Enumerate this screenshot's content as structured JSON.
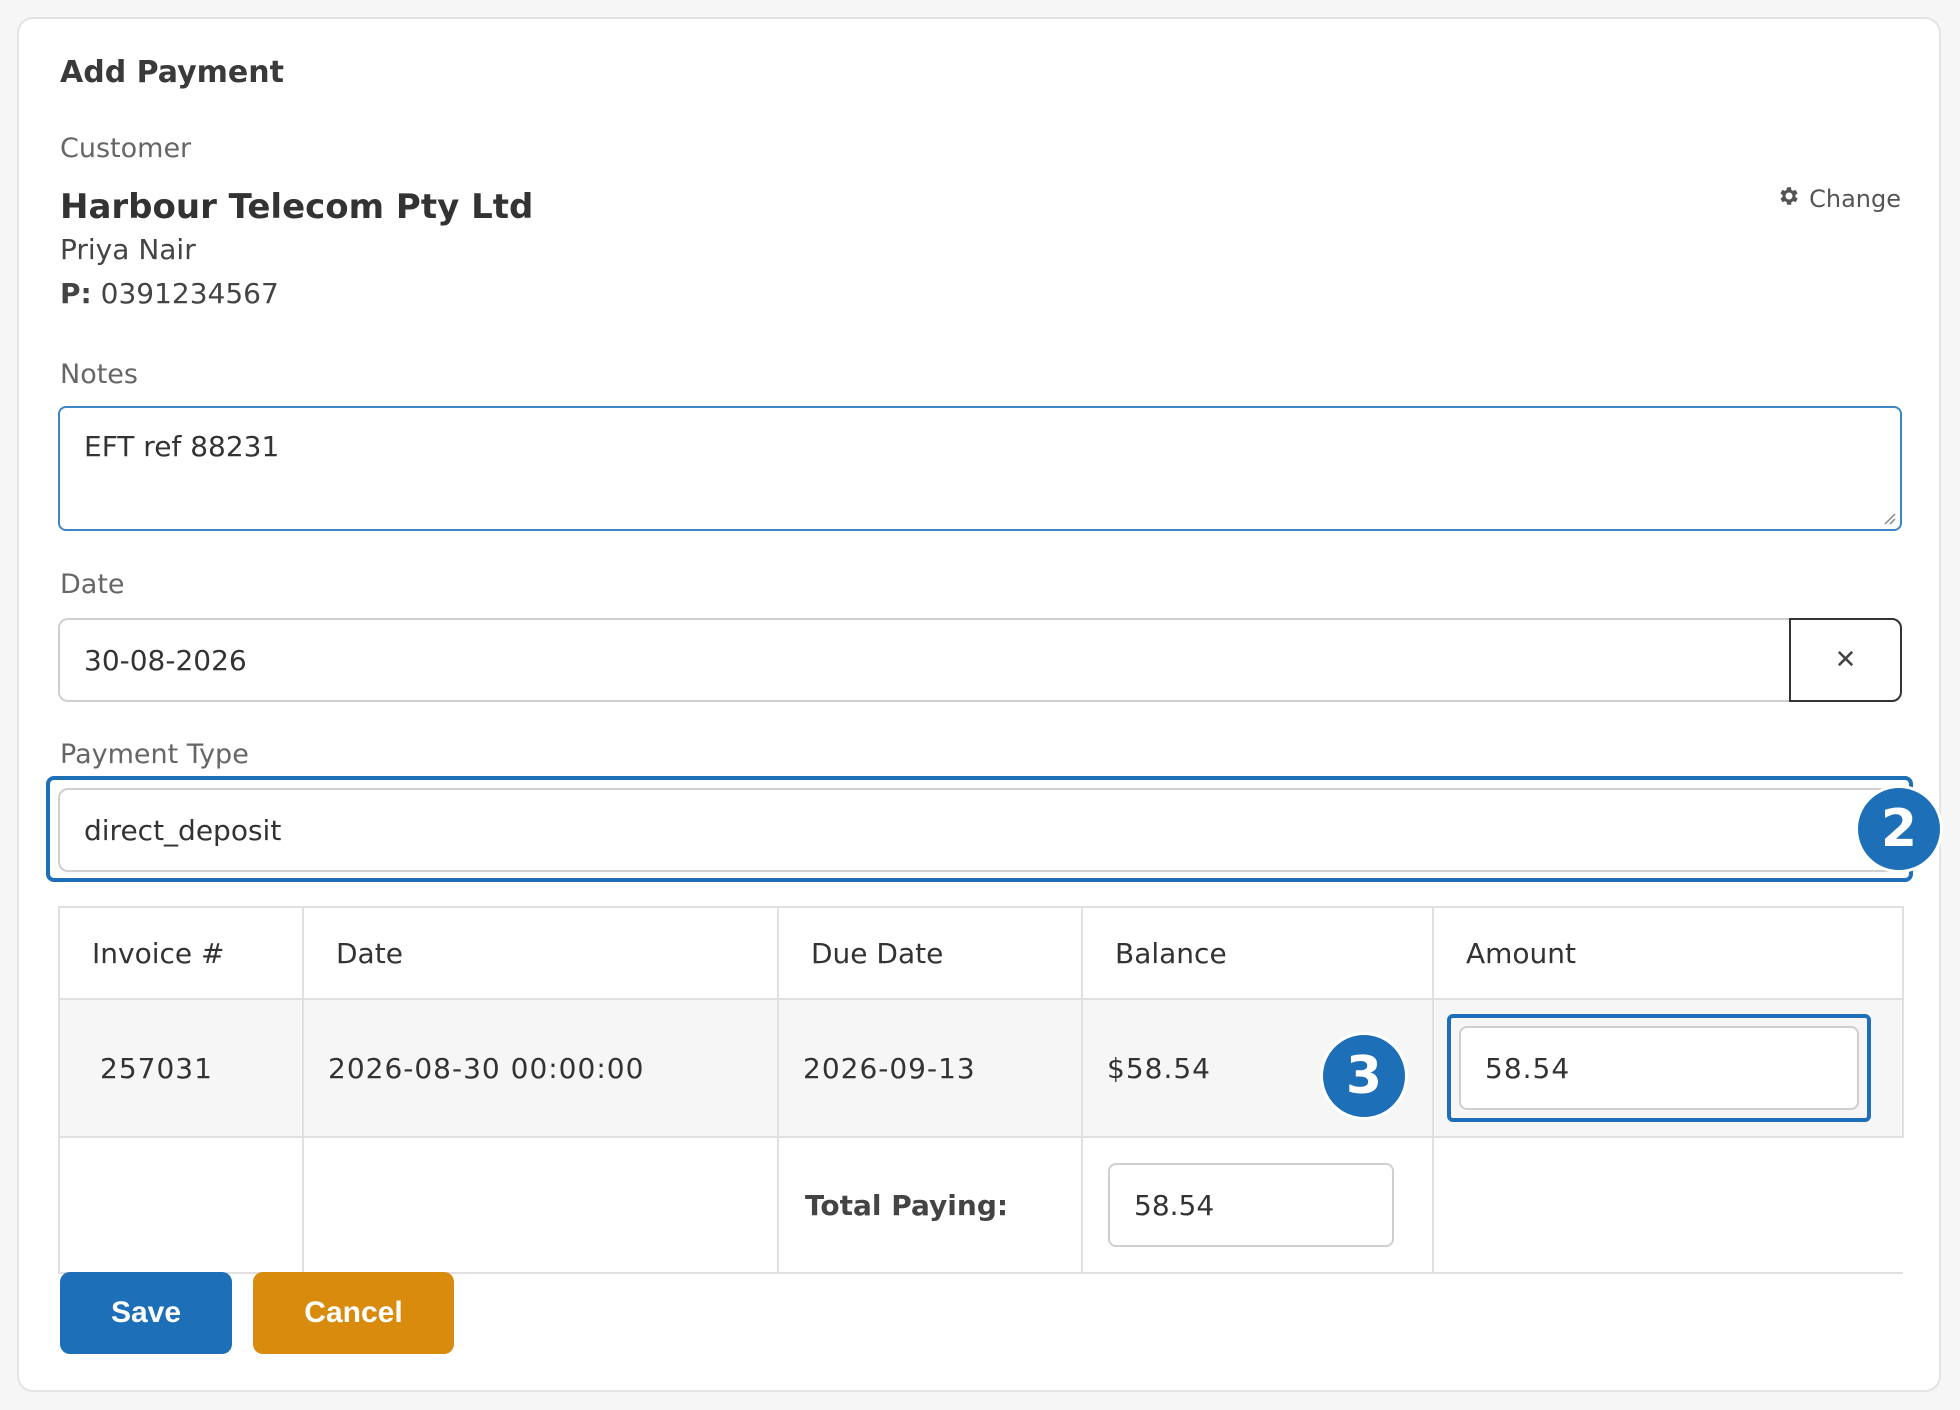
{
  "card": {
    "title": "Add Payment"
  },
  "customer": {
    "label": "Customer",
    "name": "Harbour Telecom Pty Ltd",
    "contact": "Priya Nair",
    "phone_label": "P:",
    "phone": "0391234567",
    "change_label": "Change"
  },
  "notes": {
    "label": "Notes",
    "value": "EFT ref 88231"
  },
  "date": {
    "label": "Date",
    "value": "30-08-2026",
    "clear_symbol": "✕"
  },
  "payment_type": {
    "label": "Payment Type",
    "value": "direct_deposit"
  },
  "badges": {
    "payment_type": "2",
    "amount": "3"
  },
  "table": {
    "headers": [
      "Invoice #",
      "Date",
      "Due Date",
      "Balance",
      "Amount"
    ],
    "rows": [
      {
        "invoice": "257031",
        "date": "2026-08-30 00:00:00",
        "due_date": "2026-09-13",
        "balance": "$58.54",
        "amount": "58.54"
      }
    ],
    "total_label": "Total Paying:",
    "total_value": "58.54"
  },
  "actions": {
    "save": "Save",
    "cancel": "Cancel"
  },
  "colors": {
    "primary": "#1d6fb8",
    "warning": "#d98b0e"
  }
}
